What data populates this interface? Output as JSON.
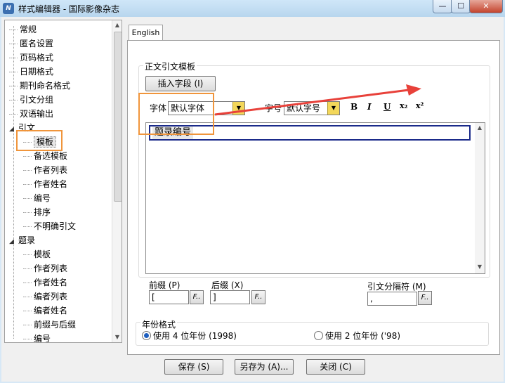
{
  "window": {
    "title": "样式编辑器 - 国际影像杂志",
    "app_icon": "N",
    "min_glyph": "—",
    "max_glyph": "☐",
    "close_glyph": "✕"
  },
  "tree": {
    "items": [
      {
        "label": "常规",
        "level": 0
      },
      {
        "label": "匿名设置",
        "level": 0
      },
      {
        "label": "页码格式",
        "level": 0
      },
      {
        "label": "日期格式",
        "level": 0
      },
      {
        "label": "期刊命名格式",
        "level": 0
      },
      {
        "label": "引文分组",
        "level": 0
      },
      {
        "label": "双语输出",
        "level": 0
      },
      {
        "label": "引文",
        "level": 0,
        "expanded": true
      },
      {
        "label": "模板",
        "level": 1,
        "selected": true
      },
      {
        "label": "备选模板",
        "level": 1
      },
      {
        "label": "作者列表",
        "level": 1
      },
      {
        "label": "作者姓名",
        "level": 1
      },
      {
        "label": "编号",
        "level": 1
      },
      {
        "label": "排序",
        "level": 1
      },
      {
        "label": "不明确引文",
        "level": 1
      },
      {
        "label": "题录",
        "level": 0,
        "expanded": true
      },
      {
        "label": "模板",
        "level": 1
      },
      {
        "label": "作者列表",
        "level": 1
      },
      {
        "label": "作者姓名",
        "level": 1
      },
      {
        "label": "编者列表",
        "level": 1
      },
      {
        "label": "编者姓名",
        "level": 1
      },
      {
        "label": "前缀与后缀",
        "level": 1
      },
      {
        "label": "编号",
        "level": 1
      }
    ]
  },
  "tab": {
    "label": "English"
  },
  "template_group": {
    "title": "正文引文模板",
    "insert_field_button": "插入字段 (I)",
    "font_label": "字体",
    "font_value": "默认字体",
    "size_label": "字号",
    "size_value": "默认字号",
    "bold": "B",
    "italic": "I",
    "underline": "U",
    "subscript": "x₂",
    "superscript": "x²",
    "field_chip": "题录编号"
  },
  "affixes": {
    "prefix_label": "前缀 (P)",
    "prefix_value": "[",
    "suffix_label": "后缀 (X)",
    "suffix_value": "]",
    "separator_label": "引文分隔符 (M)",
    "separator_value": ",",
    "format_button": "F.."
  },
  "year_format": {
    "title": "年份格式",
    "option_4digit": "使用 4 位年份 (1998)",
    "option_2digit": "使用 2 位年份 ('98)",
    "selected": "4digit"
  },
  "footer": {
    "save": "保存 (S)",
    "save_as": "另存为 (A)...",
    "close": "关闭 (C)"
  },
  "colors": {
    "annotation_box": "#f0953b",
    "annotation_arrow": "#e8413a"
  }
}
